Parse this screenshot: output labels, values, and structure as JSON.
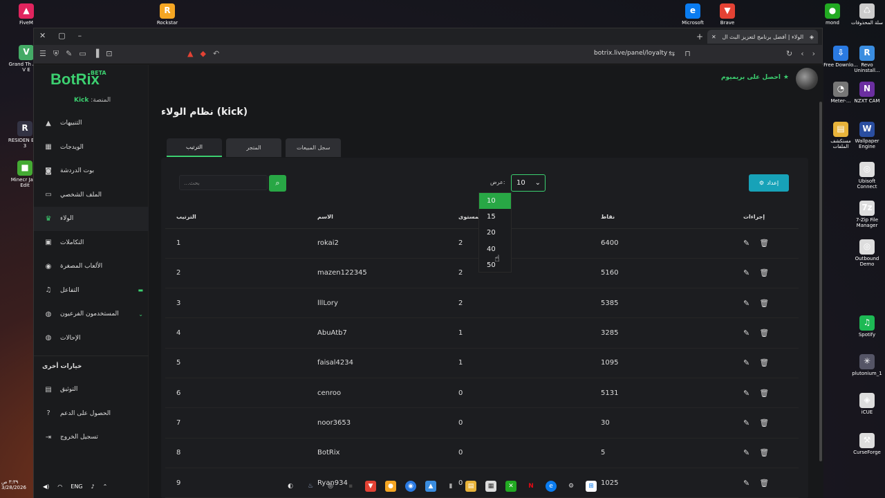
{
  "desktop": {
    "left_icons": [
      {
        "label": "FiveM",
        "color": "#e0245e",
        "glyph": "▲"
      },
      {
        "label": "Grand Th Auto V E",
        "color": "#4a6",
        "glyph": "V"
      },
      {
        "label": "RESIDEN EVIL 3",
        "color": "#334",
        "glyph": "R"
      },
      {
        "label": "Minecr Java Edit",
        "color": "#4a3",
        "glyph": "■"
      }
    ],
    "top_icons": [
      {
        "label": "Rockstar",
        "color": "#f5a623",
        "glyph": "R"
      },
      {
        "label": "Microsoft",
        "color": "#0a7cf0",
        "glyph": "e"
      },
      {
        "label": "Brave",
        "color": "#e34234",
        "glyph": "▼"
      },
      {
        "label": "mond",
        "color": "#2a2",
        "glyph": "●"
      },
      {
        "label": "سلة المحذوفات",
        "color": "#ccc",
        "glyph": "♺"
      }
    ],
    "right_icons": [
      {
        "label": "Free Downlo...",
        "color": "#2a7ae2",
        "glyph": "⇩"
      },
      {
        "label": "Revo Uninstall...",
        "color": "#3a8de0",
        "glyph": "R"
      },
      {
        "label": "Meter-...",
        "color": "#777",
        "glyph": "◔"
      },
      {
        "label": "NZXT CAM",
        "color": "#6b2fa0",
        "glyph": "N"
      },
      {
        "label": "مستكشف الملفات",
        "color": "#e8b33a",
        "glyph": "▤"
      },
      {
        "label": "Wallpaper Engine",
        "color": "#2a4ea0",
        "glyph": "W"
      },
      {
        "label": "Ubisoft Connect",
        "color": "#ddd",
        "glyph": "◎"
      },
      {
        "label": "7-Zip File Manager",
        "color": "#ddd",
        "glyph": "7z"
      },
      {
        "label": "Outbound Demo",
        "color": "#ddd",
        "glyph": "◎"
      },
      {
        "label": "Spotify",
        "color": "#1db954",
        "glyph": "♫"
      },
      {
        "label": "plutonium_1",
        "color": "#556",
        "glyph": "✳"
      },
      {
        "label": "iCUE",
        "color": "#ddd",
        "glyph": "◈"
      },
      {
        "label": "CurseForge",
        "color": "#ddd",
        "glyph": "⚒"
      }
    ]
  },
  "browser": {
    "tab_title": "الولاء | أفضل برنامج لتعزيز البث ال",
    "url": "botrix.live/panel/loyalty"
  },
  "app": {
    "logo": "BotRix",
    "beta": "BETA",
    "platform_label": "المنصة:",
    "platform_value": "Kick",
    "premium": "احصل على بريميوم",
    "page_title": "نظام الولاء (kick)"
  },
  "sidebar": {
    "items": [
      {
        "label": "التنبيهات",
        "icon": "alert-icon",
        "glyph": "▲"
      },
      {
        "label": "الويدجات",
        "icon": "widgets-icon",
        "glyph": "▦"
      },
      {
        "label": "بوت الدردشة",
        "icon": "bot-icon",
        "glyph": "◙"
      },
      {
        "label": "الملف الشخصي",
        "icon": "profile-icon",
        "glyph": "▭"
      },
      {
        "label": "الولاء",
        "icon": "trophy-icon",
        "glyph": "♛"
      },
      {
        "label": "التكاملات",
        "icon": "integrations-icon",
        "glyph": "▣"
      },
      {
        "label": "الألعاب المصغرة",
        "icon": "gamepad-icon",
        "glyph": "◉"
      },
      {
        "label": "التفاعل",
        "icon": "music-icon",
        "glyph": "♫"
      },
      {
        "label": "المستخدمون الفرعيون",
        "icon": "users-icon",
        "glyph": "◍"
      },
      {
        "label": "الإحالات",
        "icon": "referrals-icon",
        "glyph": "◍"
      }
    ],
    "section_title": "خيارات أخرى",
    "other_items": [
      {
        "label": "التوثيق",
        "icon": "docs-icon",
        "glyph": "▤"
      },
      {
        "label": "الحصول على الدعم",
        "icon": "help-icon",
        "glyph": "?"
      },
      {
        "label": "تسجيل الخروج",
        "icon": "logout-icon",
        "glyph": "⇥"
      }
    ]
  },
  "tabs": [
    {
      "label": "الترتيب",
      "active": true
    },
    {
      "label": "المتجر",
      "active": false
    },
    {
      "label": "سجل المبيعات",
      "active": false
    }
  ],
  "controls": {
    "search_placeholder": "بحث...",
    "show_label": "عرض:",
    "page_size": "10",
    "page_size_options": [
      "10",
      "15",
      "20",
      "40",
      "50"
    ],
    "setup_button": "إعداد"
  },
  "table": {
    "headers": [
      "الترتيب",
      "الاسم",
      "المستوى",
      "نقاط",
      "إجراءات"
    ],
    "rows": [
      {
        "rank": "1",
        "name": "rokai2",
        "level": "2",
        "points": "6400"
      },
      {
        "rank": "2",
        "name": "mazen122345",
        "level": "2",
        "points": "5160"
      },
      {
        "rank": "3",
        "name": "lllLory",
        "level": "2",
        "points": "5385"
      },
      {
        "rank": "4",
        "name": "AbuAtb7",
        "level": "1",
        "points": "3285"
      },
      {
        "rank": "5",
        "name": "faisal4234",
        "level": "1",
        "points": "1095"
      },
      {
        "rank": "6",
        "name": "cenroo",
        "level": "0",
        "points": "5131"
      },
      {
        "rank": "7",
        "name": "noor3653",
        "level": "0",
        "points": "30"
      },
      {
        "rank": "8",
        "name": "BotRix",
        "level": "0",
        "points": "5"
      },
      {
        "rank": "9",
        "name": "Ryan934",
        "level": "0",
        "points": "1025"
      }
    ]
  },
  "taskbar": {
    "time": "٣:٣٩ ص",
    "date": "3/28/2026",
    "lang": "ENG"
  }
}
